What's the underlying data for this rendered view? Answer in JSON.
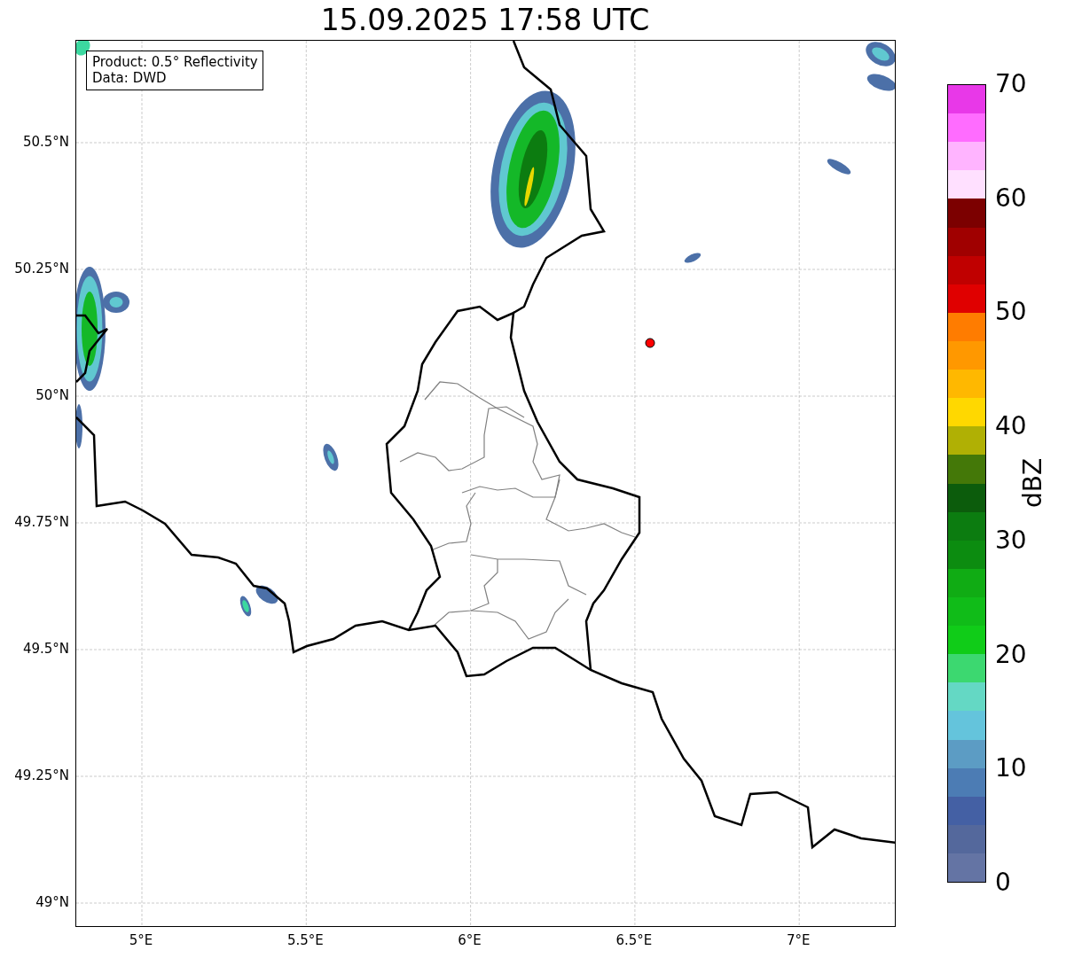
{
  "title": "15.09.2025 17:58 UTC",
  "map": {
    "info_box": [
      "Product: 0.5° Reflectivity",
      "Data: DWD"
    ],
    "lat_labels": [
      "50.5°N",
      "50.25°N",
      "50°N",
      "49.75°N",
      "49.5°N",
      "49.25°N",
      "49°N"
    ],
    "lon_labels": [
      "5°E",
      "5.5°E",
      "6°E",
      "6.5°E",
      "7°E"
    ]
  },
  "colorbar": {
    "label": "dBZ",
    "tick_labels": [
      "70",
      "60",
      "50",
      "40",
      "30",
      "20",
      "10",
      "0"
    ],
    "bins": [
      {
        "color": "#e838e8"
      },
      {
        "color": "#ff6cff"
      },
      {
        "color": "#ffb4ff"
      },
      {
        "color": "#ffe0ff"
      },
      {
        "color": "#7c0000"
      },
      {
        "color": "#a00000"
      },
      {
        "color": "#c00000"
      },
      {
        "color": "#e00000"
      },
      {
        "color": "#ff7c00"
      },
      {
        "color": "#ff9800"
      },
      {
        "color": "#ffb800"
      },
      {
        "color": "#ffd800"
      },
      {
        "color": "#b0b004"
      },
      {
        "color": "#447808"
      },
      {
        "color": "#0c5c0c"
      },
      {
        "color": "#0c7c10"
      },
      {
        "color": "#0c8c10"
      },
      {
        "color": "#10ac14"
      },
      {
        "color": "#10bc18"
      },
      {
        "color": "#10cc18"
      },
      {
        "color": "#3cd870"
      },
      {
        "color": "#64d8c4"
      },
      {
        "color": "#64c4dc"
      },
      {
        "color": "#5c9cc4"
      },
      {
        "color": "#4c7cb4"
      },
      {
        "color": "#4460a4"
      },
      {
        "color": "#54689c"
      },
      {
        "color": "#6474a4"
      }
    ]
  }
}
